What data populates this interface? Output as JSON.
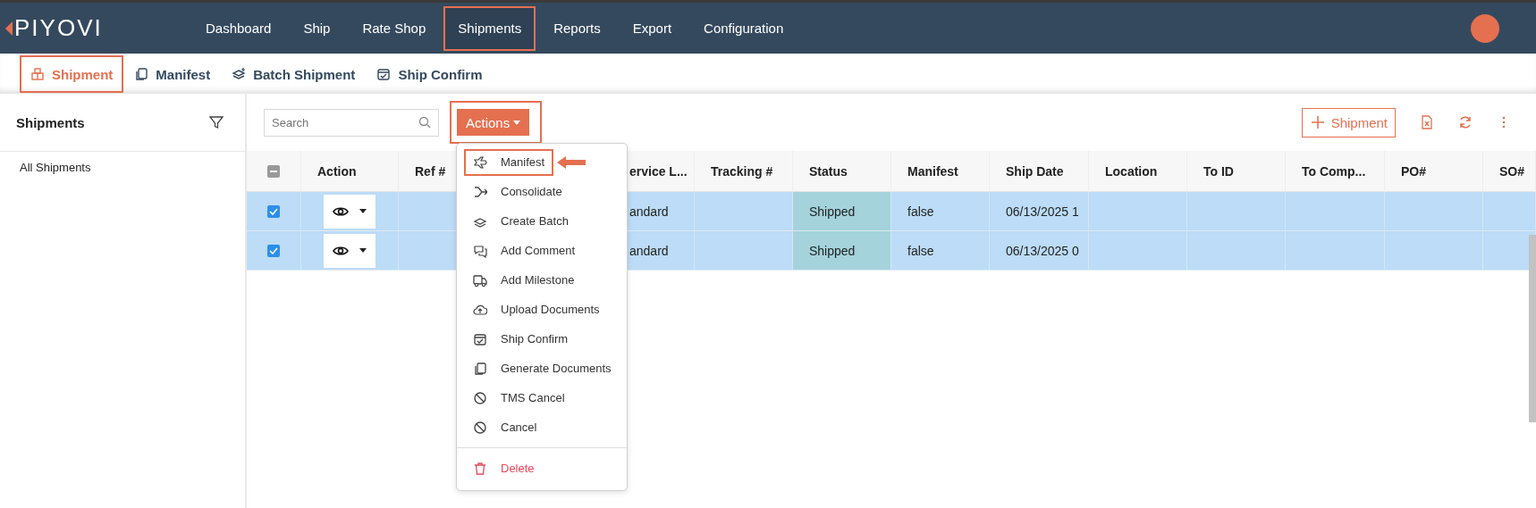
{
  "logo": "PIYOVI",
  "nav": [
    {
      "label": "Dashboard",
      "highlighted": false
    },
    {
      "label": "Ship",
      "highlighted": false
    },
    {
      "label": "Rate Shop",
      "highlighted": false
    },
    {
      "label": "Shipments",
      "highlighted": true
    },
    {
      "label": "Reports",
      "highlighted": false
    },
    {
      "label": "Export",
      "highlighted": false
    },
    {
      "label": "Configuration",
      "highlighted": false
    }
  ],
  "subtabs": [
    {
      "label": "Shipment",
      "selected": true,
      "highlighted": true
    },
    {
      "label": "Manifest",
      "selected": false,
      "highlighted": false
    },
    {
      "label": "Batch Shipment",
      "selected": false,
      "highlighted": false
    },
    {
      "label": "Ship Confirm",
      "selected": false,
      "highlighted": false
    }
  ],
  "sidebar": {
    "title": "Shipments",
    "items": [
      "All Shipments"
    ]
  },
  "toolbar": {
    "search": {
      "placeholder": "Search"
    },
    "actions_button": {
      "label": "Actions",
      "highlighted": true
    },
    "add_button": {
      "label": "Shipment"
    }
  },
  "table": {
    "header_checkbox_partial": true,
    "columns": [
      "Action",
      "Ref #",
      "ervice L...",
      "Tracking #",
      "Status",
      "Manifest",
      "Ship Date",
      "Location",
      "To ID",
      "To Comp...",
      "PO#",
      "SO#"
    ],
    "rows": [
      {
        "selected": true,
        "service": "andard",
        "status": "Shipped",
        "manifest": "false",
        "ship_date": "06/13/2025 1"
      },
      {
        "selected": true,
        "service": "andard",
        "status": "Shipped",
        "manifest": "false",
        "ship_date": "06/13/2025 0"
      }
    ]
  },
  "menu": {
    "items": [
      {
        "label": "Manifest",
        "kind": "normal",
        "highlighted": true
      },
      {
        "label": "Consolidate",
        "kind": "normal",
        "highlighted": false
      },
      {
        "label": "Create Batch",
        "kind": "normal",
        "highlighted": false
      },
      {
        "label": "Add Comment",
        "kind": "normal",
        "highlighted": false
      },
      {
        "label": "Add Milestone",
        "kind": "normal",
        "highlighted": false
      },
      {
        "label": "Upload Documents",
        "kind": "normal",
        "highlighted": false
      },
      {
        "label": "Ship Confirm",
        "kind": "normal",
        "highlighted": false
      },
      {
        "label": "Generate Documents",
        "kind": "normal",
        "highlighted": false
      },
      {
        "label": "TMS Cancel",
        "kind": "normal",
        "highlighted": false
      },
      {
        "label": "Cancel",
        "kind": "normal",
        "highlighted": false
      },
      {
        "label": "Delete",
        "kind": "danger",
        "highlighted": false
      }
    ]
  }
}
